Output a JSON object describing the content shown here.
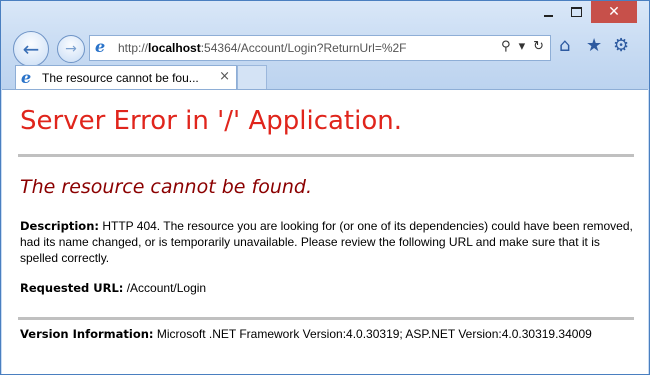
{
  "browser": {
    "window_controls": {
      "minimize": "",
      "maximize": "",
      "close": "✕"
    },
    "nav": {
      "back_icon": "←",
      "forward_icon": "→"
    },
    "address": {
      "url_prefix": "http://",
      "url_host": "localhost",
      "url_rest": ":54364/Account/Login?ReturnUrl=%2F",
      "search_icon": "⚲",
      "dropdown_icon": "▾",
      "refresh_icon": "↻"
    },
    "tools": {
      "home_icon": "⌂",
      "favorites_icon": "★",
      "settings_icon": "⚙"
    },
    "tab": {
      "label": "The resource cannot be fou...",
      "close_icon": "×"
    }
  },
  "page": {
    "title": "Server Error in '/' Application.",
    "subtitle": "The resource cannot be found.",
    "description_label": "Description:",
    "description_text": "HTTP 404. The resource you are looking for (or one of its dependencies) could have been removed, had its name changed, or is temporarily unavailable.  Please review the following URL and make sure that it is spelled correctly.",
    "requested_url_label": "Requested URL:",
    "requested_url_value": "/Account/Login",
    "version_label": "Version Information:",
    "version_value": "Microsoft .NET Framework Version:4.0.30319; ASP.NET Version:4.0.30319.34009"
  },
  "colors": {
    "title_red": "#e0251c",
    "subtitle_darkred": "#8b0000",
    "close_button": "#c7504a"
  }
}
